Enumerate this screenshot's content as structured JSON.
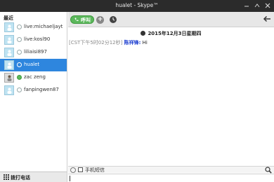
{
  "window": {
    "title": "hualet - Skype™",
    "controls": [
      "minimize",
      "maximize",
      "close"
    ]
  },
  "sidebar": {
    "header": "最近",
    "contacts": [
      {
        "name": "live:michaeljayt",
        "status": "offline",
        "avatar": "default-avatar-icon"
      },
      {
        "name": "live:kosl90",
        "status": "offline",
        "avatar": "default-avatar-icon"
      },
      {
        "name": "liliaisi897",
        "status": "offline",
        "avatar": "default-avatar-icon"
      },
      {
        "name": "hualet",
        "status": "offline",
        "avatar": "default-avatar-icon",
        "selected": true
      },
      {
        "name": "zac zeng",
        "status": "online",
        "avatar": "photo-avatar"
      },
      {
        "name": "fanpingwen87",
        "status": "offline",
        "avatar": "default-avatar-icon"
      }
    ],
    "dial_label": "拨打电话"
  },
  "toolbar": {
    "call_label": "呼叫",
    "add_label": "+",
    "accent": "#5cb85c"
  },
  "chat": {
    "date": "2015年12月3日星期四",
    "messages": [
      {
        "timestamp": "[CST下午5时02分12秒]",
        "sender": "陈祥锋:",
        "text": "Hi"
      }
    ]
  },
  "composer": {
    "sms_label": "手机短信",
    "value": ""
  },
  "colors": {
    "selection": "#2e86de",
    "titlebar": "#2b2b2b",
    "sender": "#1a3ccf"
  }
}
